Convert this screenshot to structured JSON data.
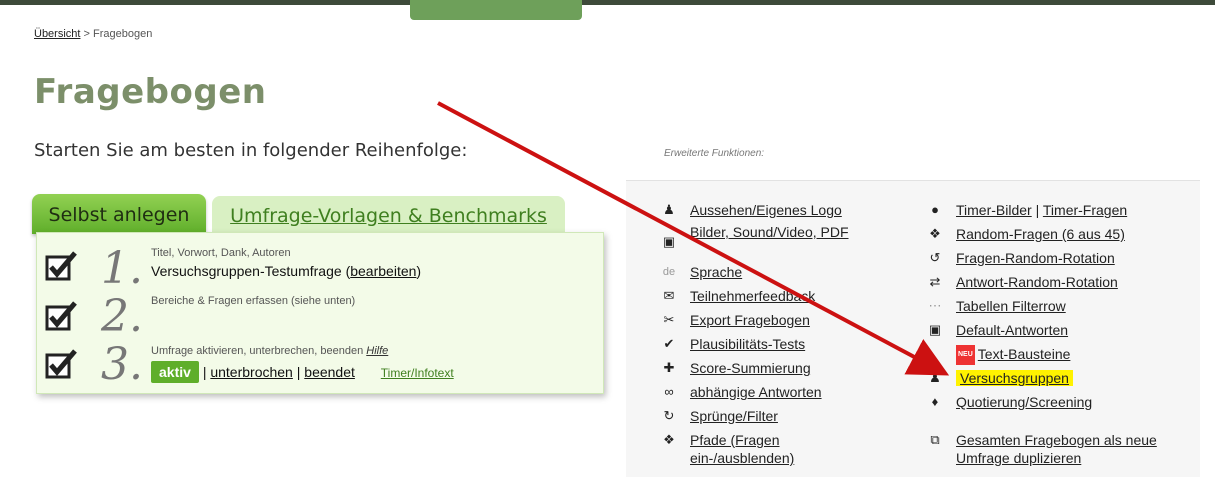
{
  "breadcrumb": {
    "home": "Übersicht",
    "sep": " > ",
    "current": "Fragebogen"
  },
  "page_title": "Fragebogen",
  "subtitle": "Starten Sie am besten in folgender Reihenfolge:",
  "extended_label": "Erweiterte Funktionen:",
  "tabs": {
    "selbst": "Selbst anlegen",
    "vorlagen": "Umfrage-Vorlagen & Benchmarks"
  },
  "steps": [
    {
      "num": "1.",
      "small": "Titel, Vorwort, Dank, Autoren",
      "main": "Versuchsgruppen-Testumfrage",
      "edit_open": "(",
      "edit": "bearbeiten",
      "edit_close": ")"
    },
    {
      "num": "2.",
      "small": "Bereiche & Fragen erfassen (siehe unten)"
    },
    {
      "num": "3.",
      "small": "Umfrage aktivieren, unterbrechen, beenden",
      "help": "Hilfe",
      "aktiv": "aktiv",
      "sep": " | ",
      "unterbrochen": "unterbrochen",
      "beendet": "beendet",
      "timer": "Timer/Infotext"
    }
  ],
  "functions_left": [
    {
      "icon": "person-icon",
      "label": "Aussehen/Eigenes Logo"
    },
    {
      "icon": "image-icon",
      "label": "Bilder, Sound/Video, PDF"
    },
    {
      "icon": "language-icon",
      "label": "Sprache"
    },
    {
      "icon": "feedback-icon",
      "label": "Teilnehmerfeedback"
    },
    {
      "icon": "scissors-icon",
      "label": "Export Fragebogen"
    },
    {
      "icon": "check-icon",
      "label": "Plausibilitäts-Tests"
    },
    {
      "icon": "plus-icon",
      "label": "Score-Summierung"
    },
    {
      "icon": "link-icon",
      "label": "abhängige Antworten"
    },
    {
      "icon": "jump-icon",
      "label": "Sprünge/Filter"
    },
    {
      "icon": "signpost-icon",
      "label": "Pfade (Fragen ein-/ausblenden)"
    }
  ],
  "functions_right": {
    "timer_bilder": "Timer-Bilder",
    "timer_sep": " | ",
    "timer_fragen": "Timer-Fragen",
    "random_fragen": "Random-Fragen (6 aus 45)",
    "fragen_random": "Fragen-Random-Rotation",
    "antwort_random": "Antwort-Random-Rotation",
    "tabellen": "Tabellen Filterrow",
    "default": "Default-Antworten",
    "new_badge": "NEU",
    "text_bausteine": "Text-Bausteine",
    "versuchsgruppen": "Versuchsgruppen",
    "quotierung": "Quotierung/Screening",
    "duplizieren": "Gesamten Fragebogen als neue Umfrage duplizieren"
  },
  "colors": {
    "title": "#7c8f6a",
    "tab_active": "#5fae2a",
    "highlight": "#fff200",
    "arrow": "#cc1111"
  }
}
